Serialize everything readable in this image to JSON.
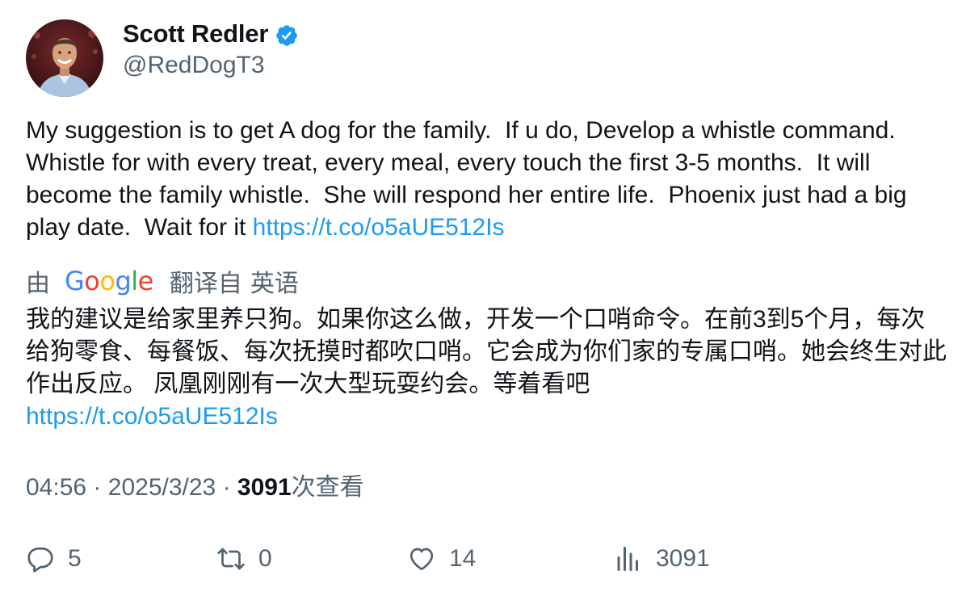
{
  "author": {
    "display_name": "Scott Redler",
    "handle": "@RedDogT3",
    "verified_icon": "verified-badge-icon",
    "avatar_icon": "avatar-photo"
  },
  "tweet": {
    "text": "My suggestion is to get A dog for the family.  If u do, Develop a whistle command. Whistle for with every treat, every meal, every touch the first 3-5 months.  It will become the family whistle.  She will respond her entire life.  Phoenix just had a big play date.  Wait for it ",
    "link": "https://t.co/o5aUE512Is"
  },
  "translation": {
    "by_label": "由",
    "provider": "Google",
    "translated_from_label": "翻译自",
    "source_language": "英语",
    "text": "我的建议是给家里养只狗。如果你这么做，开发一个口哨命令。在前3到5个月，每次给狗零食、每餐饭、每次抚摸时都吹口哨。它会成为你们家的专属口哨。她会终生对此作出反应。 凤凰刚刚有一次大型玩耍约会。等着看吧",
    "link": "https://t.co/o5aUE512Is"
  },
  "meta": {
    "time": "04:56",
    "separator": "·",
    "date": "2025/3/23",
    "views_count": "3091",
    "views_label": "次查看"
  },
  "actions": {
    "reply": {
      "icon": "reply-icon",
      "count": "5"
    },
    "retweet": {
      "icon": "retweet-icon",
      "count": "0"
    },
    "like": {
      "icon": "heart-icon",
      "count": "14"
    },
    "views": {
      "icon": "analytics-icon",
      "count": "3091"
    }
  },
  "colors": {
    "link": "#1d9bf0",
    "secondary_text": "#536471",
    "primary_text": "#0f1419",
    "verified": "#1d9bf0"
  }
}
